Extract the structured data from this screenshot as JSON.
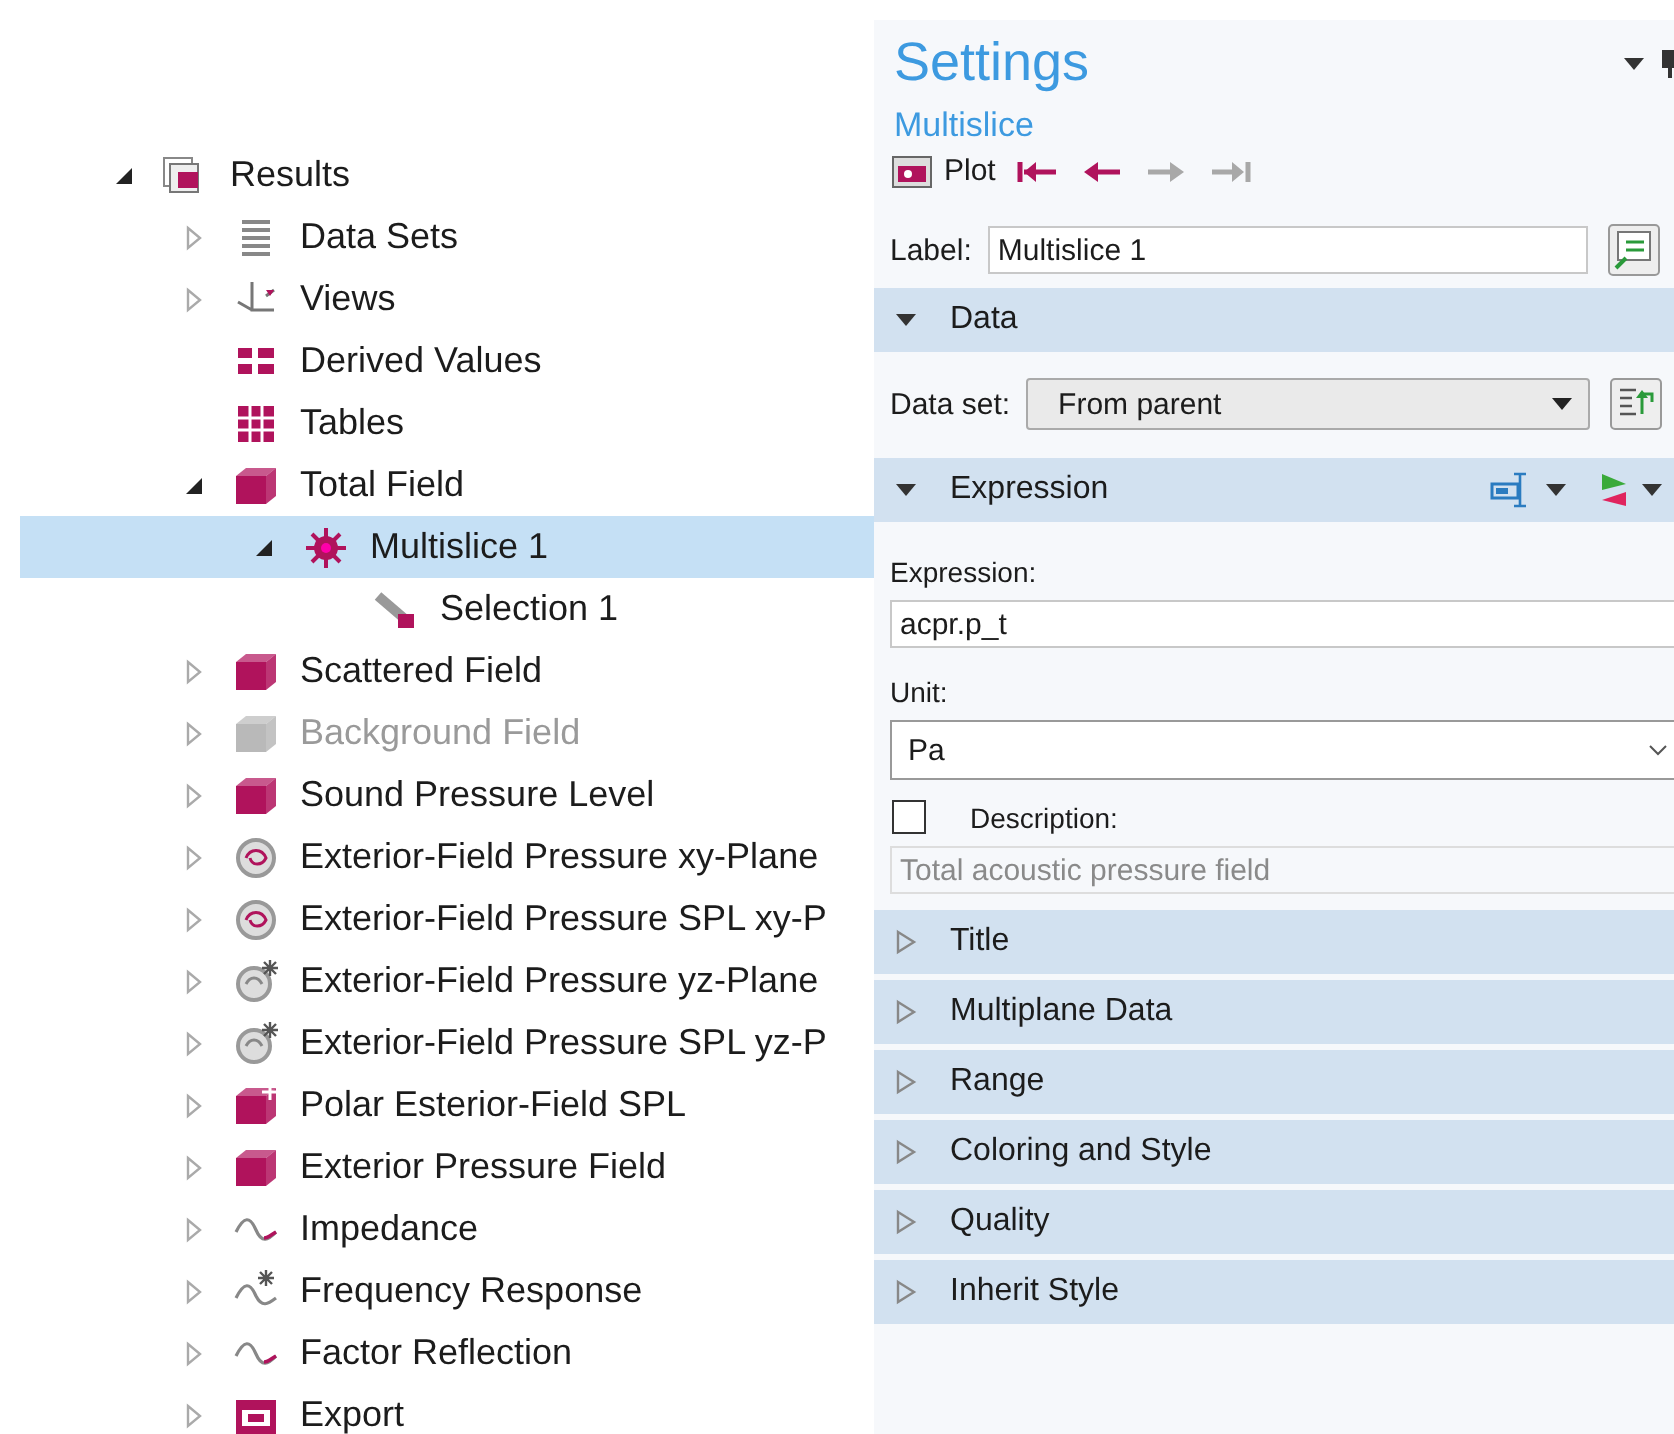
{
  "tree": {
    "items": [
      {
        "label": "Results",
        "kind": "results",
        "expanded": true,
        "selected": false,
        "disabled": false,
        "children": [
          {
            "label": "Data Sets",
            "kind": "datasets",
            "expanded": false,
            "selected": false,
            "disabled": false
          },
          {
            "label": "Views",
            "kind": "views",
            "expanded": false,
            "selected": false,
            "disabled": false
          },
          {
            "label": "Derived Values",
            "kind": "derived",
            "selected": false,
            "disabled": false
          },
          {
            "label": "Tables",
            "kind": "tables",
            "selected": false,
            "disabled": false
          },
          {
            "label": "Total Field",
            "kind": "plotgroup",
            "expanded": true,
            "selected": false,
            "disabled": false,
            "children": [
              {
                "label": "Multislice 1",
                "kind": "multislice",
                "expanded": true,
                "selected": true,
                "disabled": false,
                "children": [
                  {
                    "label": "Selection 1",
                    "kind": "selection",
                    "selected": false,
                    "disabled": false
                  }
                ]
              }
            ]
          },
          {
            "label": "Scattered Field",
            "kind": "plotgroup",
            "expanded": false,
            "selected": false,
            "disabled": false
          },
          {
            "label": "Background Field",
            "kind": "plotgroup",
            "expanded": false,
            "selected": false,
            "disabled": true
          },
          {
            "label": "Sound Pressure Level",
            "kind": "plotgroup",
            "expanded": false,
            "selected": false,
            "disabled": false
          },
          {
            "label": "Exterior-Field Pressure xy-Plane",
            "kind": "sphere",
            "expanded": false,
            "selected": false,
            "disabled": false
          },
          {
            "label": "Exterior-Field Pressure SPL xy-P",
            "kind": "sphere",
            "expanded": false,
            "selected": false,
            "disabled": false
          },
          {
            "label": "Exterior-Field Pressure yz-Plane",
            "kind": "sphere-star",
            "expanded": false,
            "selected": false,
            "disabled": false
          },
          {
            "label": "Exterior-Field Pressure SPL yz-P",
            "kind": "sphere-star",
            "expanded": false,
            "selected": false,
            "disabled": false
          },
          {
            "label": "Polar Esterior-Field SPL",
            "kind": "polar",
            "expanded": false,
            "selected": false,
            "disabled": false
          },
          {
            "label": "Exterior Pressure Field",
            "kind": "plotgroup",
            "expanded": false,
            "selected": false,
            "disabled": false
          },
          {
            "label": "Impedance",
            "kind": "wave",
            "expanded": false,
            "selected": false,
            "disabled": false
          },
          {
            "label": "Frequency Response",
            "kind": "wave-star",
            "expanded": false,
            "selected": false,
            "disabled": false
          },
          {
            "label": "Factor Reflection",
            "kind": "wave",
            "expanded": false,
            "selected": false,
            "disabled": false
          },
          {
            "label": "Export",
            "kind": "export",
            "expanded": false,
            "selected": false,
            "disabled": false
          }
        ]
      }
    ]
  },
  "settings": {
    "title": "Settings",
    "subtitle": "Multislice",
    "toolbar": {
      "label": "Plot",
      "nav": [
        {
          "kind": "first",
          "disabled": false
        },
        {
          "kind": "previous",
          "disabled": false
        },
        {
          "kind": "next",
          "disabled": true
        },
        {
          "kind": "last",
          "disabled": true
        }
      ]
    },
    "label_field": {
      "label": "Label:",
      "value": "Multislice 1"
    },
    "sections": [
      {
        "title": "Data",
        "expanded": true,
        "dataset": {
          "label": "Data set:",
          "value": "From parent"
        }
      },
      {
        "title": "Expression",
        "expanded": true,
        "expression": {
          "label": "Expression:",
          "value": "acpr.p_t"
        },
        "unit": {
          "label": "Unit:",
          "value": "Pa"
        },
        "description": {
          "label": "Description:",
          "checked": false,
          "value": "Total acoustic pressure field"
        }
      },
      {
        "title": "Title",
        "expanded": false
      },
      {
        "title": "Multiplane Data",
        "expanded": false
      },
      {
        "title": "Range",
        "expanded": false
      },
      {
        "title": "Coloring and Style",
        "expanded": false
      },
      {
        "title": "Quality",
        "expanded": false
      },
      {
        "title": "Inherit Style",
        "expanded": false
      }
    ]
  }
}
